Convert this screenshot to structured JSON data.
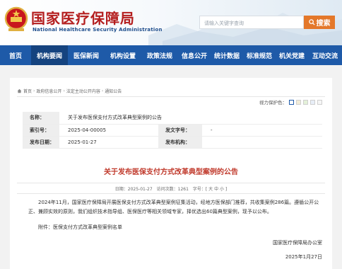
{
  "header": {
    "title": "国家医疗保障局",
    "subtitle": "National Healthcare Security Administration",
    "search_placeholder": "请输入关键字查询",
    "search_button": "搜索"
  },
  "nav": {
    "items": [
      {
        "label": "首页",
        "active": false
      },
      {
        "label": "机构要闻",
        "active": true
      },
      {
        "label": "医保新闻",
        "active": false
      },
      {
        "label": "机构设置",
        "active": false
      },
      {
        "label": "政策法规",
        "active": false
      },
      {
        "label": "信息公开",
        "active": false
      },
      {
        "label": "统计数据",
        "active": false
      },
      {
        "label": "标准规范",
        "active": false
      },
      {
        "label": "机关党建",
        "active": false
      },
      {
        "label": "互动交流",
        "active": false
      }
    ]
  },
  "breadcrumb": [
    "首页",
    "政府信息公开",
    "法定主动公开内容",
    "通知公告"
  ],
  "vision": {
    "label": "视力保护色：",
    "colors": [
      "#ffffff",
      "#f3ecd7",
      "#e4f1d9",
      "#e8eef8",
      "#f6f6f6"
    ]
  },
  "meta": {
    "name_label": "名称：",
    "name_value": "关于发布医保支付方式改革典型案例的公告",
    "index_label": "索引号：",
    "index_value": "2025-04-00005",
    "docno_label": "发文字号：",
    "docno_value": "-",
    "date_label": "发布日期：",
    "date_value": "2025-01-27",
    "org_label": "发布机构："
  },
  "article": {
    "title": "关于发布医保支付方式改革典型案例的公告",
    "date": "日期：2025-01-27",
    "views": "访问次数：1261",
    "font_size_label": "字号：[ 大 中 小 ]",
    "body": "2024年11月，国家医疗保障局开展医保支付方式改革典型案例征集活动，经地方医保部门推荐，共收集案例286篇。遵循公开公正、兼顾实效的原则，我们组织技术指导组、医保医疗等相关领域专家，择优选出60篇典型案例，现予以公布。",
    "attachment": "附件：医保支付方式改革典型案例名单",
    "signature_org": "国家医疗保障局办公室",
    "signature_date": "2025年1月27日"
  }
}
